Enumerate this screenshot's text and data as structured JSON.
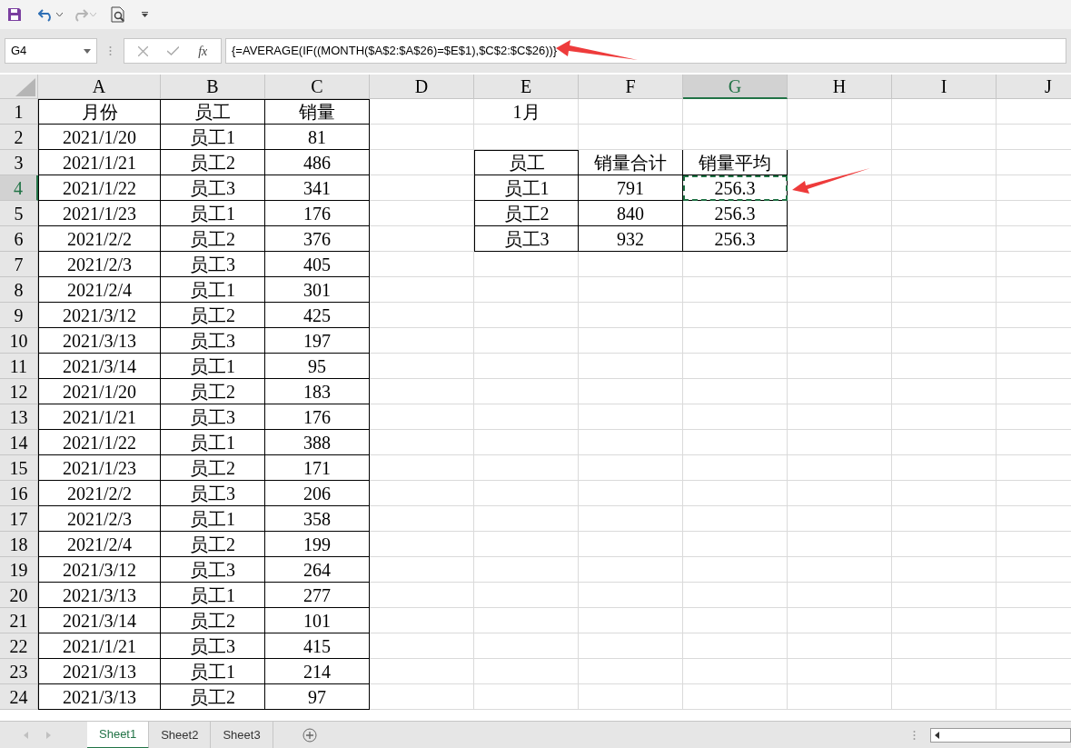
{
  "formula_bar": {
    "name_box": "G4",
    "function_label": "fx",
    "formula": "{=AVERAGE(IF((MONTH($A$2:$A$26)=$E$1),$C$2:$C$26))}"
  },
  "columns": [
    {
      "label": "A",
      "selected": false
    },
    {
      "label": "B",
      "selected": false
    },
    {
      "label": "C",
      "selected": false
    },
    {
      "label": "D",
      "selected": false
    },
    {
      "label": "E",
      "selected": false
    },
    {
      "label": "F",
      "selected": false
    },
    {
      "label": "G",
      "selected": true
    },
    {
      "label": "H",
      "selected": false
    },
    {
      "label": "I",
      "selected": false
    },
    {
      "label": "J",
      "selected": false
    }
  ],
  "row_headers": [
    {
      "label": "1",
      "selected": false
    },
    {
      "label": "2",
      "selected": false
    },
    {
      "label": "3",
      "selected": false
    },
    {
      "label": "4",
      "selected": true
    },
    {
      "label": "5",
      "selected": false
    },
    {
      "label": "6",
      "selected": false
    },
    {
      "label": "7",
      "selected": false
    },
    {
      "label": "8",
      "selected": false
    },
    {
      "label": "9",
      "selected": false
    },
    {
      "label": "10",
      "selected": false
    },
    {
      "label": "11",
      "selected": false
    },
    {
      "label": "12",
      "selected": false
    },
    {
      "label": "13",
      "selected": false
    },
    {
      "label": "14",
      "selected": false
    },
    {
      "label": "15",
      "selected": false
    },
    {
      "label": "16",
      "selected": false
    },
    {
      "label": "17",
      "selected": false
    },
    {
      "label": "18",
      "selected": false
    },
    {
      "label": "19",
      "selected": false
    },
    {
      "label": "20",
      "selected": false
    },
    {
      "label": "21",
      "selected": false
    },
    {
      "label": "22",
      "selected": false
    },
    {
      "label": "23",
      "selected": false
    },
    {
      "label": "24",
      "selected": false
    }
  ],
  "sales_table": {
    "headers": [
      "月份",
      "员工",
      "销量"
    ],
    "rows": [
      [
        "2021/1/20",
        "员工1",
        "81"
      ],
      [
        "2021/1/21",
        "员工2",
        "486"
      ],
      [
        "2021/1/22",
        "员工3",
        "341"
      ],
      [
        "2021/1/23",
        "员工1",
        "176"
      ],
      [
        "2021/2/2",
        "员工2",
        "376"
      ],
      [
        "2021/2/3",
        "员工3",
        "405"
      ],
      [
        "2021/2/4",
        "员工1",
        "301"
      ],
      [
        "2021/3/12",
        "员工2",
        "425"
      ],
      [
        "2021/3/13",
        "员工3",
        "197"
      ],
      [
        "2021/3/14",
        "员工1",
        "95"
      ],
      [
        "2021/1/20",
        "员工2",
        "183"
      ],
      [
        "2021/1/21",
        "员工3",
        "176"
      ],
      [
        "2021/1/22",
        "员工1",
        "388"
      ],
      [
        "2021/1/23",
        "员工2",
        "171"
      ],
      [
        "2021/2/2",
        "员工3",
        "206"
      ],
      [
        "2021/2/3",
        "员工1",
        "358"
      ],
      [
        "2021/2/4",
        "员工2",
        "199"
      ],
      [
        "2021/3/12",
        "员工3",
        "264"
      ],
      [
        "2021/3/13",
        "员工1",
        "277"
      ],
      [
        "2021/3/14",
        "员工2",
        "101"
      ],
      [
        "2021/1/21",
        "员工3",
        "415"
      ],
      [
        "2021/3/13",
        "员工1",
        "214"
      ],
      [
        "2021/3/13",
        "员工2",
        "97"
      ]
    ]
  },
  "month_cell": "1月",
  "summary_table": {
    "headers": [
      "员工",
      "销量合计",
      "销量平均"
    ],
    "rows": [
      {
        "employee": "员工1",
        "total": "791",
        "average": "256.3",
        "average_selected": true
      },
      {
        "employee": "员工2",
        "total": "840",
        "average": "256.3",
        "average_selected": false
      },
      {
        "employee": "员工3",
        "total": "932",
        "average": "256.3",
        "average_selected": false
      }
    ]
  },
  "sheets": [
    {
      "name": "Sheet1",
      "selected": true
    },
    {
      "name": "Sheet2",
      "selected": false
    },
    {
      "name": "Sheet3",
      "selected": false
    }
  ]
}
